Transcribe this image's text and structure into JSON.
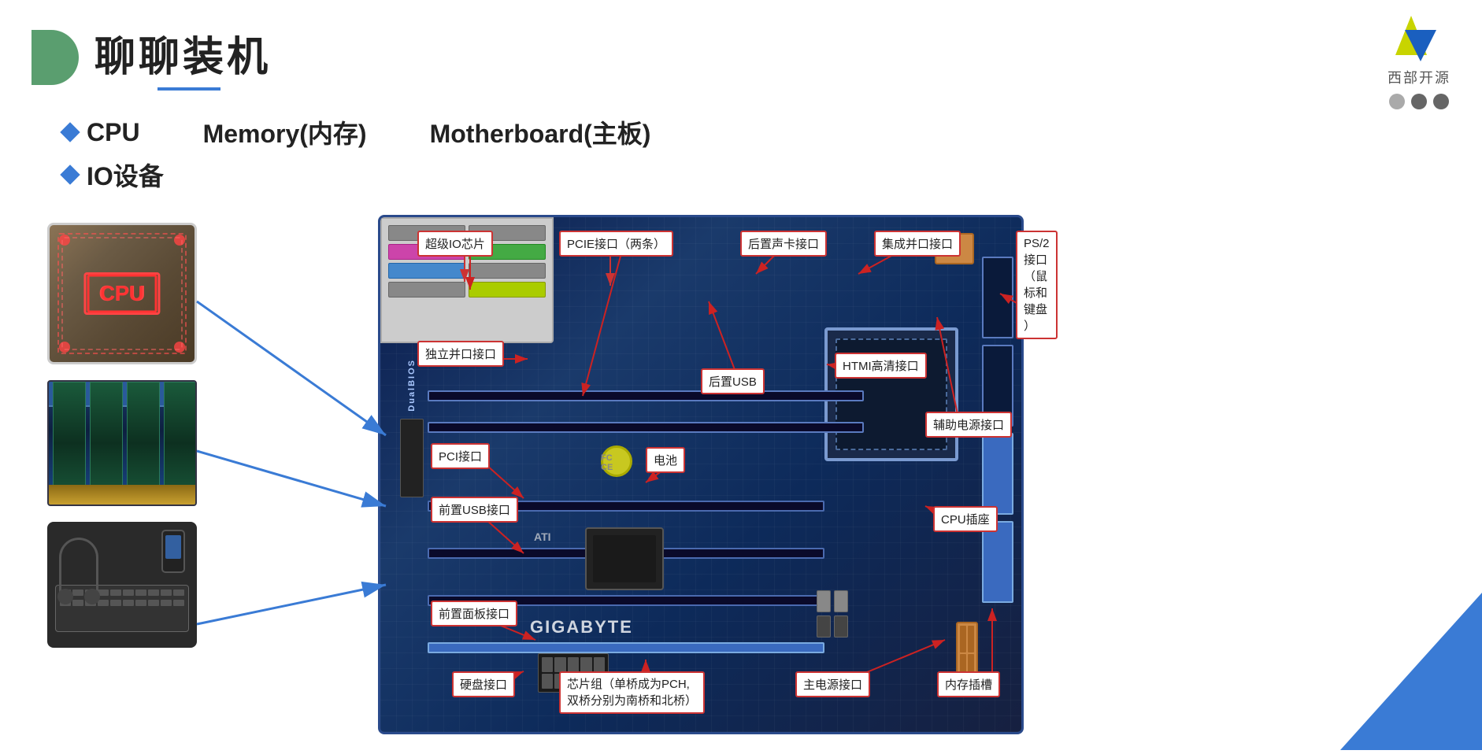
{
  "header": {
    "title": "聊聊装机",
    "underline_color": "#3a7bd5"
  },
  "logo": {
    "text": "西部开源",
    "dots": [
      "gray",
      "dark",
      "dark"
    ]
  },
  "items": [
    {
      "label": "CPU",
      "extra": "Memory(内存)",
      "extra2": "Motherboard(主板)"
    },
    {
      "label": "IO设备"
    }
  ],
  "motherboard_callouts": [
    {
      "id": "super-io",
      "text": "超级IO芯片"
    },
    {
      "id": "pcie",
      "text": "PCIE接口（两条）"
    },
    {
      "id": "rear-sound",
      "text": "后置声卡接口"
    },
    {
      "id": "parallel-integrated",
      "text": "集成并口接口"
    },
    {
      "id": "ps2",
      "text": "PS/2\n接口\n（鼠\n标和\n键盘\n）"
    },
    {
      "id": "parallel-standalone",
      "text": "独立并口接口"
    },
    {
      "id": "hdmi",
      "text": "HTMI高清接口"
    },
    {
      "id": "rear-usb",
      "text": "后置USB"
    },
    {
      "id": "aux-power",
      "text": "辅助电源接口"
    },
    {
      "id": "pci",
      "text": "PCI接口"
    },
    {
      "id": "battery",
      "text": "电池"
    },
    {
      "id": "cpu-socket",
      "text": "CPU插座"
    },
    {
      "id": "front-usb",
      "text": "前置USB接口"
    },
    {
      "id": "front-panel",
      "text": "前置面板接口"
    },
    {
      "id": "hdd",
      "text": "硬盘接口"
    },
    {
      "id": "chipset",
      "text": "芯片组（单桥成为PCH,\n双桥分别为南桥和北桥）"
    },
    {
      "id": "main-power",
      "text": "主电源接口"
    },
    {
      "id": "ram-slot",
      "text": "内存插槽"
    }
  ],
  "components": {
    "cpu_label": "CPU",
    "memory_label": "Memory(内存)",
    "motherboard_label": "Motherboard(主板)",
    "io_label": "IO设备"
  }
}
